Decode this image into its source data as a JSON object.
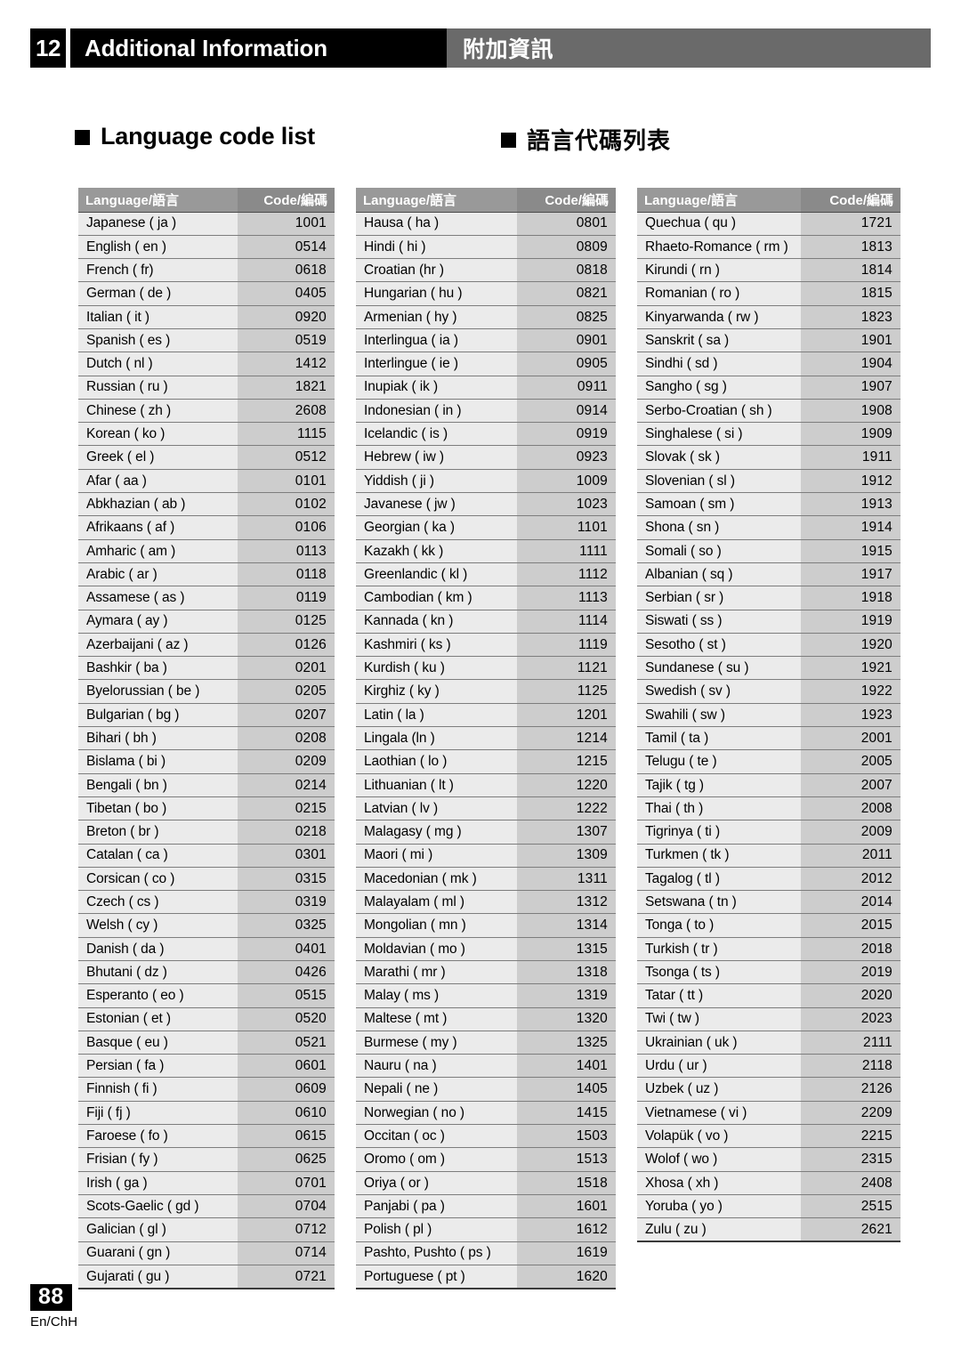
{
  "header": {
    "chapter_number": "12",
    "title_en": "Additional Information",
    "title_cn": "附加資訊"
  },
  "sections": {
    "heading_en": "Language code list",
    "heading_cn": "語言代碼列表"
  },
  "table": {
    "col_header_language": "Language/語言",
    "col_header_code": "Code/編碼",
    "columns": [
      {
        "rows": [
          {
            "language": "Japanese ( ja )",
            "code": "1001"
          },
          {
            "language": "English ( en )",
            "code": "0514"
          },
          {
            "language": "French ( fr)",
            "code": "0618"
          },
          {
            "language": "German ( de )",
            "code": "0405"
          },
          {
            "language": "Italian ( it )",
            "code": "0920"
          },
          {
            "language": "Spanish ( es )",
            "code": "0519"
          },
          {
            "language": "Dutch ( nl )",
            "code": "1412"
          },
          {
            "language": "Russian ( ru )",
            "code": "1821"
          },
          {
            "language": "Chinese ( zh )",
            "code": "2608"
          },
          {
            "language": "Korean ( ko )",
            "code": "1115"
          },
          {
            "language": "Greek ( el )",
            "code": "0512"
          },
          {
            "language": "Afar ( aa )",
            "code": "0101"
          },
          {
            "language": "Abkhazian ( ab )",
            "code": "0102"
          },
          {
            "language": "Afrikaans ( af )",
            "code": "0106"
          },
          {
            "language": "Amharic ( am )",
            "code": "0113"
          },
          {
            "language": "Arabic ( ar )",
            "code": "0118"
          },
          {
            "language": "Assamese ( as )",
            "code": "0119"
          },
          {
            "language": "Aymara ( ay )",
            "code": "0125"
          },
          {
            "language": "Azerbaijani ( az )",
            "code": "0126"
          },
          {
            "language": "Bashkir ( ba )",
            "code": "0201"
          },
          {
            "language": "Byelorussian ( be )",
            "code": "0205"
          },
          {
            "language": "Bulgarian ( bg )",
            "code": "0207"
          },
          {
            "language": "Bihari ( bh )",
            "code": "0208"
          },
          {
            "language": "Bislama ( bi )",
            "code": "0209"
          },
          {
            "language": "Bengali ( bn )",
            "code": "0214"
          },
          {
            "language": "Tibetan ( bo )",
            "code": "0215"
          },
          {
            "language": "Breton ( br )",
            "code": "0218"
          },
          {
            "language": "Catalan ( ca )",
            "code": "0301"
          },
          {
            "language": "Corsican ( co )",
            "code": "0315"
          },
          {
            "language": "Czech ( cs )",
            "code": "0319"
          },
          {
            "language": "Welsh ( cy )",
            "code": "0325"
          },
          {
            "language": "Danish ( da )",
            "code": "0401"
          },
          {
            "language": "Bhutani ( dz )",
            "code": "0426"
          },
          {
            "language": "Esperanto ( eo )",
            "code": "0515"
          },
          {
            "language": "Estonian ( et )",
            "code": "0520"
          },
          {
            "language": "Basque ( eu )",
            "code": "0521"
          },
          {
            "language": "Persian ( fa )",
            "code": "0601"
          },
          {
            "language": "Finnish ( fi )",
            "code": "0609"
          },
          {
            "language": "Fiji ( fj )",
            "code": "0610"
          },
          {
            "language": "Faroese ( fo )",
            "code": "0615"
          },
          {
            "language": "Frisian ( fy )",
            "code": "0625"
          },
          {
            "language": "Irish ( ga )",
            "code": "0701"
          },
          {
            "language": "Scots-Gaelic ( gd )",
            "code": "0704"
          },
          {
            "language": "Galician ( gl )",
            "code": "0712"
          },
          {
            "language": "Guarani ( gn )",
            "code": "0714"
          },
          {
            "language": "Gujarati ( gu )",
            "code": "0721"
          }
        ]
      },
      {
        "rows": [
          {
            "language": "Hausa ( ha )",
            "code": "0801"
          },
          {
            "language": "Hindi ( hi )",
            "code": "0809"
          },
          {
            "language": "Croatian (hr )",
            "code": "0818"
          },
          {
            "language": "Hungarian ( hu )",
            "code": "0821"
          },
          {
            "language": "Armenian ( hy )",
            "code": "0825"
          },
          {
            "language": "Interlingua ( ia )",
            "code": "0901"
          },
          {
            "language": "Interlingue ( ie )",
            "code": "0905"
          },
          {
            "language": "Inupiak ( ik )",
            "code": "0911"
          },
          {
            "language": "Indonesian ( in )",
            "code": "0914"
          },
          {
            "language": "Icelandic ( is )",
            "code": "0919"
          },
          {
            "language": "Hebrew ( iw )",
            "code": "0923"
          },
          {
            "language": "Yiddish ( ji )",
            "code": "1009"
          },
          {
            "language": "Javanese ( jw )",
            "code": "1023"
          },
          {
            "language": "Georgian ( ka )",
            "code": "1101"
          },
          {
            "language": "Kazakh ( kk )",
            "code": "1111"
          },
          {
            "language": "Greenlandic ( kl )",
            "code": "1112"
          },
          {
            "language": "Cambodian ( km )",
            "code": "1113"
          },
          {
            "language": "Kannada ( kn )",
            "code": "1114"
          },
          {
            "language": "Kashmiri ( ks )",
            "code": "1119"
          },
          {
            "language": "Kurdish ( ku )",
            "code": "1121"
          },
          {
            "language": "Kirghiz ( ky )",
            "code": "1125"
          },
          {
            "language": "Latin ( la )",
            "code": "1201"
          },
          {
            "language": "Lingala (ln )",
            "code": "1214"
          },
          {
            "language": "Laothian ( lo )",
            "code": "1215"
          },
          {
            "language": "Lithuanian ( lt )",
            "code": "1220"
          },
          {
            "language": "Latvian ( lv )",
            "code": "1222"
          },
          {
            "language": "Malagasy ( mg )",
            "code": "1307"
          },
          {
            "language": "Maori ( mi )",
            "code": "1309"
          },
          {
            "language": "Macedonian ( mk )",
            "code": "1311"
          },
          {
            "language": "Malayalam ( ml )",
            "code": "1312"
          },
          {
            "language": "Mongolian ( mn )",
            "code": "1314"
          },
          {
            "language": "Moldavian ( mo )",
            "code": "1315"
          },
          {
            "language": "Marathi ( mr )",
            "code": "1318"
          },
          {
            "language": "Malay ( ms )",
            "code": "1319"
          },
          {
            "language": "Maltese ( mt )",
            "code": "1320"
          },
          {
            "language": "Burmese ( my )",
            "code": "1325"
          },
          {
            "language": "Nauru ( na )",
            "code": "1401"
          },
          {
            "language": "Nepali ( ne )",
            "code": "1405"
          },
          {
            "language": "Norwegian ( no )",
            "code": "1415"
          },
          {
            "language": "Occitan ( oc )",
            "code": "1503"
          },
          {
            "language": "Oromo ( om )",
            "code": "1513"
          },
          {
            "language": "Oriya ( or )",
            "code": "1518"
          },
          {
            "language": "Panjabi ( pa )",
            "code": "1601"
          },
          {
            "language": "Polish ( pl )",
            "code": "1612"
          },
          {
            "language": "Pashto, Pushto ( ps )",
            "code": "1619"
          },
          {
            "language": "Portuguese ( pt )",
            "code": "1620"
          }
        ]
      },
      {
        "rows": [
          {
            "language": "Quechua ( qu )",
            "code": "1721"
          },
          {
            "language": "Rhaeto-Romance ( rm )",
            "code": "1813"
          },
          {
            "language": "Kirundi ( rn )",
            "code": "1814"
          },
          {
            "language": "Romanian ( ro )",
            "code": "1815"
          },
          {
            "language": "Kinyarwanda ( rw )",
            "code": "1823"
          },
          {
            "language": "Sanskrit ( sa )",
            "code": "1901"
          },
          {
            "language": "Sindhi ( sd )",
            "code": "1904"
          },
          {
            "language": "Sangho ( sg )",
            "code": "1907"
          },
          {
            "language": "Serbo-Croatian ( sh )",
            "code": "1908"
          },
          {
            "language": "Singhalese ( si )",
            "code": "1909"
          },
          {
            "language": "Slovak ( sk )",
            "code": "1911"
          },
          {
            "language": "Slovenian ( sl )",
            "code": "1912"
          },
          {
            "language": "Samoan ( sm )",
            "code": "1913"
          },
          {
            "language": "Shona ( sn )",
            "code": "1914"
          },
          {
            "language": "Somali ( so )",
            "code": "1915"
          },
          {
            "language": "Albanian ( sq )",
            "code": "1917"
          },
          {
            "language": "Serbian ( sr )",
            "code": "1918"
          },
          {
            "language": "Siswati ( ss )",
            "code": "1919"
          },
          {
            "language": "Sesotho ( st )",
            "code": "1920"
          },
          {
            "language": "Sundanese ( su )",
            "code": "1921"
          },
          {
            "language": "Swedish ( sv )",
            "code": "1922"
          },
          {
            "language": "Swahili ( sw )",
            "code": "1923"
          },
          {
            "language": "Tamil ( ta )",
            "code": "2001"
          },
          {
            "language": "Telugu ( te )",
            "code": "2005"
          },
          {
            "language": "Tajik ( tg )",
            "code": "2007"
          },
          {
            "language": "Thai ( th )",
            "code": "2008"
          },
          {
            "language": "Tigrinya ( ti )",
            "code": "2009"
          },
          {
            "language": "Turkmen ( tk )",
            "code": "2011"
          },
          {
            "language": "Tagalog ( tl )",
            "code": "2012"
          },
          {
            "language": "Setswana ( tn )",
            "code": "2014"
          },
          {
            "language": "Tonga ( to )",
            "code": "2015"
          },
          {
            "language": "Turkish ( tr )",
            "code": "2018"
          },
          {
            "language": "Tsonga ( ts )",
            "code": "2019"
          },
          {
            "language": "Tatar ( tt )",
            "code": "2020"
          },
          {
            "language": "Twi ( tw )",
            "code": "2023"
          },
          {
            "language": "Ukrainian ( uk )",
            "code": "2111"
          },
          {
            "language": "Urdu ( ur )",
            "code": "2118"
          },
          {
            "language": "Uzbek ( uz )",
            "code": "2126"
          },
          {
            "language": "Vietnamese ( vi )",
            "code": "2209"
          },
          {
            "language": "Volapük ( vo )",
            "code": "2215"
          },
          {
            "language": "Wolof ( wo )",
            "code": "2315"
          },
          {
            "language": "Xhosa ( xh )",
            "code": "2408"
          },
          {
            "language": "Yoruba ( yo )",
            "code": "2515"
          },
          {
            "language": "Zulu ( zu )",
            "code": "2621"
          }
        ]
      }
    ]
  },
  "footer": {
    "page_number": "88",
    "edition": "En/ChH"
  },
  "colors": {
    "header_black": "#000000",
    "header_gray": "#6a6a6a",
    "table_header_gray": "#999999",
    "row_language_bg": "#ebebeb",
    "row_code_bg": "#cdcdcd"
  }
}
